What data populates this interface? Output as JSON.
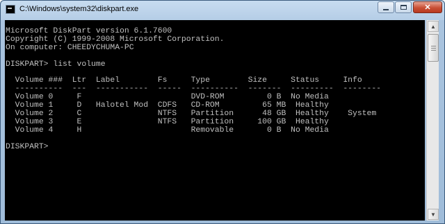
{
  "window": {
    "title": "C:\\Windows\\system32\\diskpart.exe",
    "icon": "cmd-app-icon"
  },
  "controls": {
    "minimize": "minimize-icon",
    "maximize": "maximize-icon",
    "close_glyph": "✕"
  },
  "scrollbar": {
    "up_glyph": "▲",
    "down_glyph": "▼"
  },
  "console": {
    "text": "Microsoft DiskPart version 6.1.7600\nCopyright (C) 1999-2008 Microsoft Corporation.\nOn computer: CHEEDYCHUMA-PC\n\nDISKPART> list volume\n\n  Volume ###  Ltr  Label        Fs     Type        Size     Status     Info\n  ----------  ---  -----------  -----  ----------  -------  ---------  --------\n  Volume 0     F                       DVD-ROM         0 B  No Media\n  Volume 1     D   Halotel Mod  CDFS   CD-ROM         65 MB  Healthy\n  Volume 2     C                NTFS   Partition      48 GB  Healthy    System\n  Volume 3     E                NTFS   Partition     100 GB  Healthy\n  Volume 4     H                       Removable       0 B  No Media\n\nDISKPART> "
  }
}
